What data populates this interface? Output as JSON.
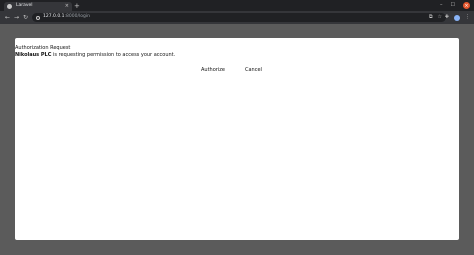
{
  "browser": {
    "tab": {
      "title": "Laravel",
      "close": "×"
    },
    "new_tab": "+",
    "window": {
      "minimize": "–",
      "maximize": "☐",
      "close": "×"
    },
    "nav": {
      "back": "←",
      "forward": "→",
      "reload": "↻"
    },
    "address": {
      "host": "127.0.0.1",
      "path": ":8000/login"
    }
  },
  "page": {
    "heading": "Authorization Request",
    "client_name": "Nikolaus PLC",
    "message": " is requesting permission to access your account.",
    "authorize_label": "Authorize",
    "cancel_label": "Cancel"
  }
}
